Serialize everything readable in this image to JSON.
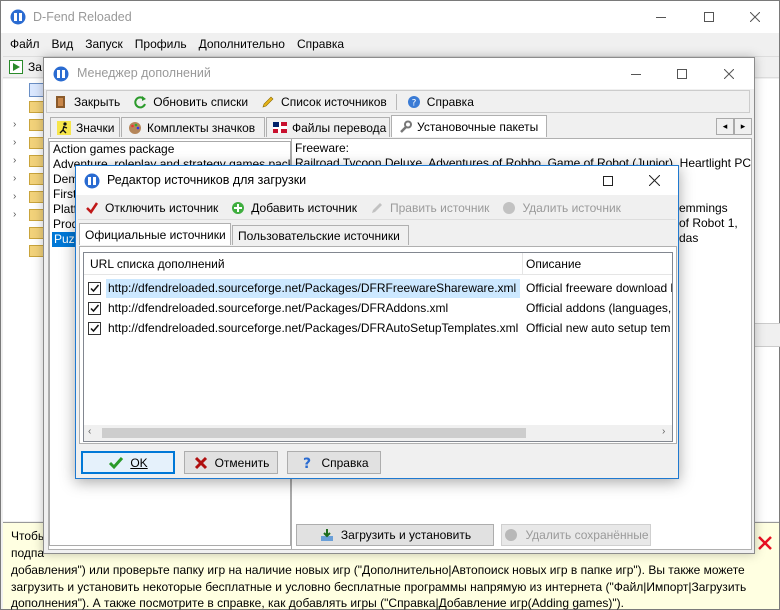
{
  "main_window": {
    "title": "D-Fend Reloaded",
    "menu": [
      "Файл",
      "Вид",
      "Запуск",
      "Профиль",
      "Дополнительно",
      "Справка"
    ],
    "toolbar_partial_label": "За",
    "hint_text_lines": [
      "Чтобы",
      "подпа",
      "добавления\") или проверьте папку игр на наличие новых игр (\"Дополнительно|Автопоиск новых игр в папке игр\"). Вы также можете",
      "загрузить и установить некоторые бесплатные и условно бесплатные программы напрямую из интернета (\"Файл|Импорт|Загрузить",
      "дополнения\"). А также посмотрите в справке, как добавлять игры (\"Справка|Добавление игр(Adding games)\")."
    ]
  },
  "addon_manager": {
    "title": "Менеджер дополнений",
    "toolbar": {
      "close": "Закрыть",
      "refresh": "Обновить списки",
      "sources": "Список источников",
      "help": "Справка"
    },
    "tabs": [
      "Значки",
      "Комплекты значков",
      "Файлы перевода",
      "Установочные пакеты"
    ],
    "active_tab": "Установочные пакеты",
    "packages": [
      "Action games package",
      "Adventure, roleplay and strategy games pack",
      "Demo",
      "First",
      "Platf",
      "Prod",
      "Puzz"
    ],
    "selected_package": "Puzz",
    "details_lines": [
      "Freeware:",
      "Railroad Tycoon Deluxe, Adventures of Robbo, Game of Robot (Junior), Heartlight PC",
      "emmings",
      "of Robot 1,",
      "das"
    ],
    "download_install": "Загрузить и установить",
    "delete_saved": "Удалить сохранённые"
  },
  "sources_editor": {
    "title": "Редактор источников для загрузки",
    "toolbar": {
      "disable": "Отключить источник",
      "add": "Добавить источник",
      "edit": "Править источник",
      "delete": "Удалить источник"
    },
    "tabs": [
      "Официальные источники",
      "Пользовательские источники"
    ],
    "active_tab": "Официальные источники",
    "columns": [
      "URL списка дополнений",
      "Описание"
    ],
    "rows": [
      {
        "checked": true,
        "url": "http://dfendreloaded.sourceforge.net/Packages/DFRFreewareShareware.xml",
        "desc": "Official freeware download l"
      },
      {
        "checked": true,
        "url": "http://dfendreloaded.sourceforge.net/Packages/DFRAddons.xml",
        "desc": "Official addons (languages,"
      },
      {
        "checked": true,
        "url": "http://dfendreloaded.sourceforge.net/Packages/DFRAutoSetupTemplates.xml",
        "desc": "Official new auto setup tem"
      }
    ],
    "buttons": {
      "ok": "OK",
      "cancel": "Отменить",
      "help": "Справка"
    }
  },
  "colors": {
    "accent": "#0078d7",
    "selection": "#0078d7",
    "row_highlight": "#cce8ff",
    "hint_bg": "#ffffe1",
    "error_red": "#e81123"
  }
}
